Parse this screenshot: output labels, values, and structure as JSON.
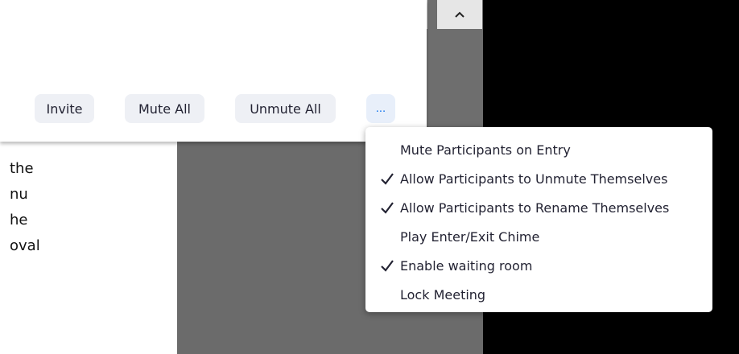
{
  "toolbar": {
    "invite_label": "Invite",
    "mute_all_label": "Mute All",
    "unmute_all_label": "Unmute All",
    "more_label": "..."
  },
  "document": {
    "lines": [
      "the",
      "nu",
      "he",
      "oval"
    ]
  },
  "menu": {
    "items": [
      {
        "label": "Mute Participants on Entry",
        "checked": false
      },
      {
        "label": "Allow Participants to Unmute Themselves",
        "checked": true
      },
      {
        "label": "Allow Participants to Rename Themselves",
        "checked": true
      },
      {
        "label": "Play Enter/Exit Chime",
        "checked": false
      },
      {
        "label": "Enable waiting room",
        "checked": true
      },
      {
        "label": "Lock Meeting",
        "checked": false
      }
    ]
  },
  "icons": {
    "scroll_up": "chevron-up-icon",
    "check": "checkmark-icon"
  },
  "colors": {
    "accent": "#0e72ed",
    "button_bg": "#eef0f5",
    "text": "#232333"
  }
}
